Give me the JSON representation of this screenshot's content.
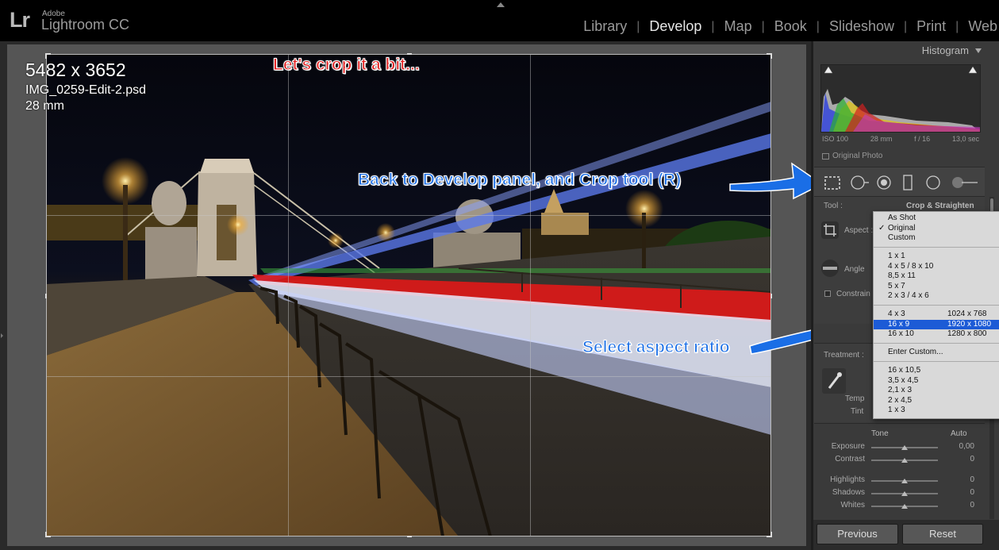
{
  "app": {
    "adobe": "Adobe",
    "name": "Lightroom CC",
    "logo": "Lr"
  },
  "modules": [
    "Library",
    "Develop",
    "Map",
    "Book",
    "Slideshow",
    "Print",
    "Web"
  ],
  "active_module": "Develop",
  "photo_info": {
    "dimensions": "5482 x 3652",
    "filename": "IMG_0259-Edit-2.psd",
    "focal": "28 mm"
  },
  "annotations": {
    "crop": "Let's crop it a bit...",
    "develop": "Back to Develop panel, and Crop tool (R)",
    "aspect": "Select aspect ratio"
  },
  "histogram": {
    "title": "Histogram",
    "iso": "ISO 100",
    "focal": "28 mm",
    "aperture": "f / 16",
    "shutter": "13,0 sec",
    "original_photo": "Original Photo"
  },
  "crop_panel": {
    "tool_label": "Tool :",
    "tool_value": "Crop & Straighten",
    "aspect_label": "Aspect :",
    "angle_label": "Angle",
    "constrain_label": "Constrain"
  },
  "dropdown": {
    "group1": [
      {
        "label": "As Shot",
        "checked": false
      },
      {
        "label": "Original",
        "checked": true
      },
      {
        "label": "Custom",
        "checked": false
      }
    ],
    "group2": [
      "1 x 1",
      "4 x 5  /  8 x 10",
      "8,5 x 11",
      "5 x 7",
      "2 x 3  /  4 x 6"
    ],
    "group3": [
      {
        "label": "4 x 3",
        "res": "1024 x 768",
        "selected": false
      },
      {
        "label": "16 x 9",
        "res": "1920 x 1080",
        "selected": true
      },
      {
        "label": "16 x 10",
        "res": "1280 x 800",
        "selected": false
      }
    ],
    "enter_custom": "Enter Custom...",
    "group4": [
      "16 x 10,5",
      "3,5 x 4,5",
      "2,1 x 3",
      "2 x 4,5",
      "1 x 3"
    ]
  },
  "treatment": {
    "label": "Treatment :",
    "temp": "Temp",
    "tint": "Tint"
  },
  "tone": {
    "title": "Tone",
    "auto": "Auto",
    "sliders": [
      {
        "label": "Exposure",
        "value": "0,00",
        "position": 0.5
      },
      {
        "label": "Contrast",
        "value": "0",
        "position": 0.5
      },
      {
        "label": "Highlights",
        "value": "0",
        "position": 0.5
      },
      {
        "label": "Shadows",
        "value": "0",
        "position": 0.5
      },
      {
        "label": "Whites",
        "value": "0",
        "position": 0.5
      }
    ]
  },
  "buttons": {
    "previous": "Previous",
    "reset": "Reset"
  },
  "colors": {
    "accent_select": "#1c5bd6",
    "annot_red": "#e31b1b",
    "annot_blue": "#1a6ee6"
  }
}
